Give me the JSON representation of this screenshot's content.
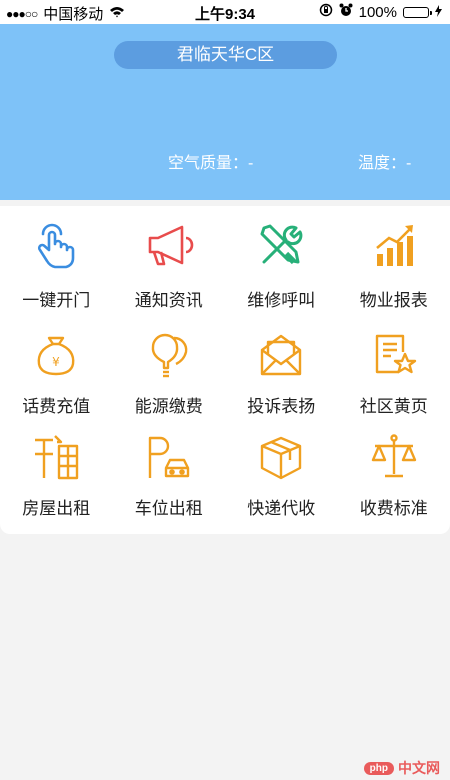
{
  "statusbar": {
    "carrier": "中国移动",
    "time": "上午9:34",
    "battery": "100%"
  },
  "header": {
    "location": "君临天华C区",
    "air_quality": "空气质量：-",
    "temperature": "温度：-"
  },
  "features": [
    {
      "label": "一键开门",
      "icon": "hand-tap-icon"
    },
    {
      "label": "通知资讯",
      "icon": "megaphone-icon"
    },
    {
      "label": "维修呼叫",
      "icon": "tools-icon"
    },
    {
      "label": "物业报表",
      "icon": "chart-icon"
    }
  ],
  "services": [
    {
      "label": "话费充值",
      "icon": "money-bag-icon"
    },
    {
      "label": "能源缴费",
      "icon": "bulb-icon"
    },
    {
      "label": "投诉表扬",
      "icon": "envelope-icon"
    },
    {
      "label": "社区黄页",
      "icon": "document-star-icon"
    },
    {
      "label": "房屋出租",
      "icon": "house-rent-icon"
    },
    {
      "label": "车位出租",
      "icon": "parking-car-icon"
    },
    {
      "label": "快递代收",
      "icon": "package-icon"
    },
    {
      "label": "收费标准",
      "icon": "scale-icon"
    }
  ],
  "watermark": {
    "logo": "php",
    "text": "中文网"
  },
  "colors": {
    "header": "#7ec2f8",
    "pill": "#5c9de0",
    "icon_orange": "#f0a020",
    "icon_blue": "#3a8de0",
    "icon_red": "#e84c4c",
    "icon_green": "#27b079"
  }
}
